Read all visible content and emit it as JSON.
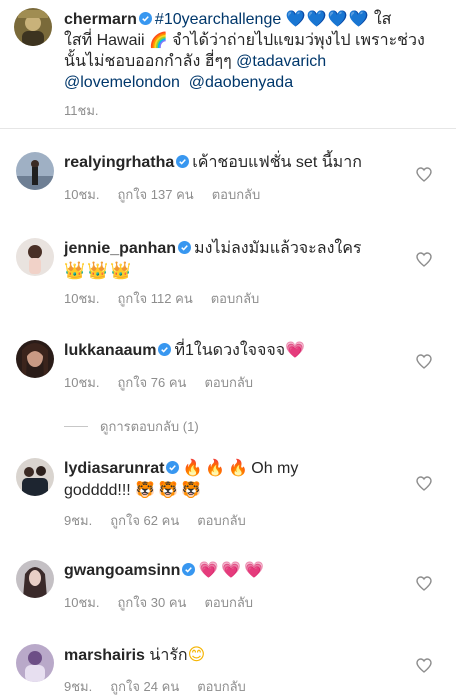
{
  "caption": {
    "username": "chermarn",
    "hashtag": "#10yearchallenge",
    "blue_hearts": "💙💙💙💙",
    "text1": " ใส",
    "text2": "ใสที่ Hawaii ",
    "rainbow": "🌈",
    "text3": " จำได้ว่าถ่ายไปแขมว่พุงไป เพราะช่วง",
    "text4": "นั้นไม่ชอบออกกำลัง ฮี่ๆๆ ",
    "mention1": "@tadavarich",
    "mention2": "@lovemelondon",
    "mention3": "@daobenyada",
    "time": "11ชม."
  },
  "comments": [
    {
      "username": "realyingrhatha",
      "verified": true,
      "text": "เค้าชอบแฟชั่น set นี้มาก",
      "time": "10ชม.",
      "likes": "ถูกใจ 137 คน",
      "reply": "ตอบกลับ"
    },
    {
      "username": "jennie_panhan",
      "verified": true,
      "text": "มงไม่ลงมัมแล้วจะลงใคร",
      "emoji": "👑👑👑",
      "time": "10ชม.",
      "likes": "ถูกใจ 112 คน",
      "reply": "ตอบกลับ"
    },
    {
      "username": "lukkanaaum",
      "verified": true,
      "text": "ที่1ในดวงใจจจจ",
      "emoji": "💗",
      "time": "10ชม.",
      "likes": "ถูกใจ 76 คน",
      "reply": "ตอบกลับ"
    },
    {
      "username": "lydiasarunrat",
      "verified": true,
      "emoji_pre": "🔥🔥🔥",
      "text": "Oh my",
      "text2": "godddd!!! ",
      "emoji": "🐯🐯🐯",
      "time": "9ชม.",
      "likes": "ถูกใจ 62 คน",
      "reply": "ตอบกลับ"
    },
    {
      "username": "gwangoamsinn",
      "verified": true,
      "emoji": "💗💗💗",
      "time": "10ชม.",
      "likes": "ถูกใจ 30 คน",
      "reply": "ตอบกลับ"
    },
    {
      "username": "marshairis",
      "verified": false,
      "text": "น่ารัก",
      "emoji": "😊",
      "time": "9ชม.",
      "likes": "ถูกใจ 24 คน",
      "reply": "ตอบกลับ"
    }
  ],
  "view_replies": "ดูการตอบกลับ (1)",
  "colors": {
    "link": "#00376b",
    "meta": "#8e8e8e",
    "verified": "#3897f0"
  }
}
